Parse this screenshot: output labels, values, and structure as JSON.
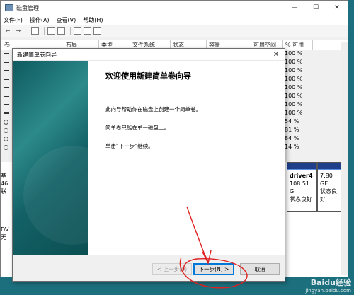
{
  "window": {
    "title": "磁盘管理",
    "controls": [
      "—",
      "☐",
      "✕"
    ]
  },
  "menu": [
    "文件(F)",
    "操作(A)",
    "查看(V)",
    "帮助(H)"
  ],
  "toolbar": {
    "nav": [
      "←",
      "→"
    ]
  },
  "columns": [
    "卷",
    "布局",
    "类型",
    "文件系统",
    "状态",
    "容量",
    "可用空间",
    "% 可用"
  ],
  "rows": [
    "100 %",
    "100 %",
    "100 %",
    "100 %",
    "100 %",
    "100 %",
    "100 %",
    "100 %",
    "54 %",
    "81 %",
    "84 %",
    "14 %"
  ],
  "disk_labels": {
    "d1": [
      "基",
      "46",
      "联"
    ],
    "d2": [
      "DV",
      "",
      "无"
    ]
  },
  "volumes": [
    {
      "name": "driver4",
      "size": "108.51 G",
      "status": "状态良好"
    },
    {
      "name": "",
      "size": "7.80 GE",
      "status": "状态良好"
    }
  ],
  "wizard": {
    "title": "新建简单卷向导",
    "close": "✕",
    "heading": "欢迎使用新建简单卷向导",
    "p1": "此向导帮助你在磁盘上创建一个简单卷。",
    "p2": "简单卷只能在单一磁盘上。",
    "p3": "单击“下一步”继续。",
    "buttons": {
      "back": "< 上一步(B)",
      "next": "下一步(N) >",
      "cancel": "取消"
    }
  },
  "colors": {
    "annotation": "#e02020",
    "side": "#1a6b70"
  },
  "watermark": {
    "line1": "Baidu经验",
    "line2": "jingyan.baidu.com"
  }
}
